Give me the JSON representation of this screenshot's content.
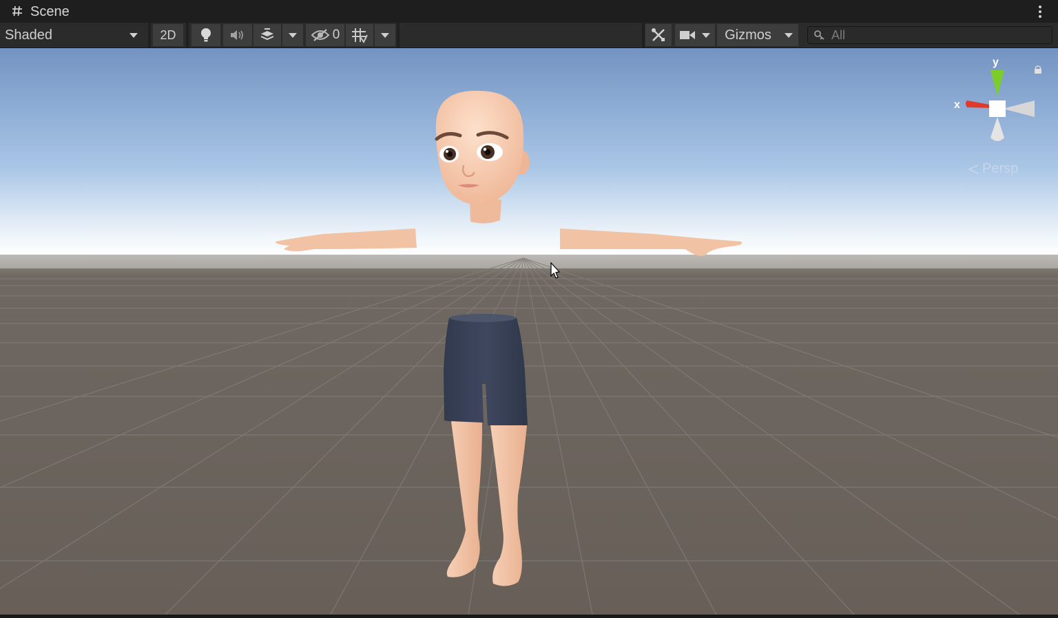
{
  "tab": {
    "title": "Scene",
    "icon": "scene-grid-icon",
    "menu_icon": "kebab-menu-icon"
  },
  "toolbar": {
    "draw_mode": "Shaded",
    "toggle_2d": "2D",
    "lighting_icon": "lightbulb-icon",
    "audio_icon": "speaker-icon",
    "effects_icon": "layers-effects-icon",
    "hidden_count": "0",
    "visibility_icon": "eye-slash-icon",
    "grid_icon": "grid-snap-icon",
    "tools_icon": "tools-icon",
    "camera_icon": "camera-icon",
    "gizmos": "Gizmos",
    "search_placeholder": "All"
  },
  "gizmo": {
    "y_label": "y",
    "x_label": "x",
    "projection": "Persp",
    "lock_icon": "lock-icon"
  },
  "colors": {
    "sky_top": "#6f95c8",
    "horizon": "#ffffff",
    "ground": "#6a625c",
    "skin": "#f4c4a6",
    "shorts": "#3c4459",
    "axis_x": "#e03a2a",
    "axis_y": "#7ccc2c"
  }
}
